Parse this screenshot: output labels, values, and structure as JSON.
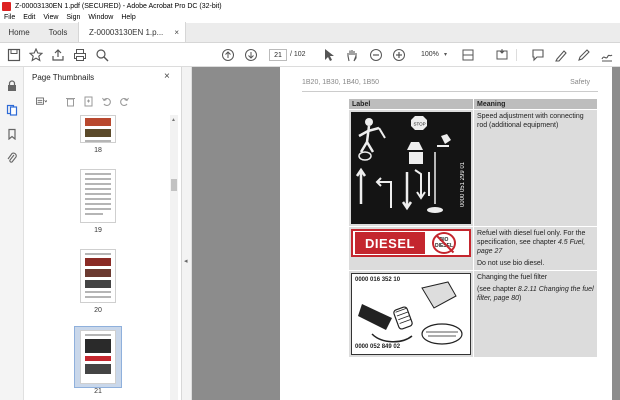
{
  "window": {
    "title": "Z-00003130EN 1.pdf (SECURED) - Adobe Acrobat Pro DC (32-bit)"
  },
  "menu": [
    "File",
    "Edit",
    "View",
    "Sign",
    "Window",
    "Help"
  ],
  "tabs": {
    "home": "Home",
    "tools": "Tools",
    "document": "Z-00003130EN 1.p...",
    "close": "×"
  },
  "toolbar": {
    "page_current": "21",
    "page_total": "/ 102",
    "zoom": "100%",
    "zoom_chevron": "▾"
  },
  "panel": {
    "title": "Page Thumbnails",
    "close": "×",
    "thumbnails": [
      {
        "label": "18"
      },
      {
        "label": "19"
      },
      {
        "label": "20"
      },
      {
        "label": "21",
        "selected": true
      }
    ]
  },
  "collapse_chevron": "◂",
  "document_page": {
    "header_left": "1B20, 1B30, 1B40, 1B50",
    "header_right": "Safety",
    "table": {
      "headers": [
        "Label",
        "Meaning"
      ],
      "rows": [
        {
          "label_serial": "0000 051 299 01",
          "meaning": [
            "Speed adjustment with connecting rod (additional equipment)"
          ]
        },
        {
          "label_word": "DIESEL",
          "label_bio_top": "BIO",
          "label_bio_bottom": "DIESEL",
          "meaning_prefix": "Refuel with diesel fuel only. For the specification, see chapter ",
          "meaning_italic": "4.5 Fuel, page 27",
          "meaning_2": "Do not use bio diesel."
        },
        {
          "label_top": "0000 016 352 10",
          "label_bottom": "0000 052 849 02",
          "meaning_1": "Changing the fuel filter",
          "meaning_prefix": "(see chapter ",
          "meaning_italic": "8.2.11 Changing the fuel filter, page 80",
          "meaning_suffix": ")"
        }
      ]
    }
  },
  "colors": {
    "label_red": "#c4262e",
    "doc_bg": "#8c8c8c",
    "selection": "#c9d7ea"
  }
}
